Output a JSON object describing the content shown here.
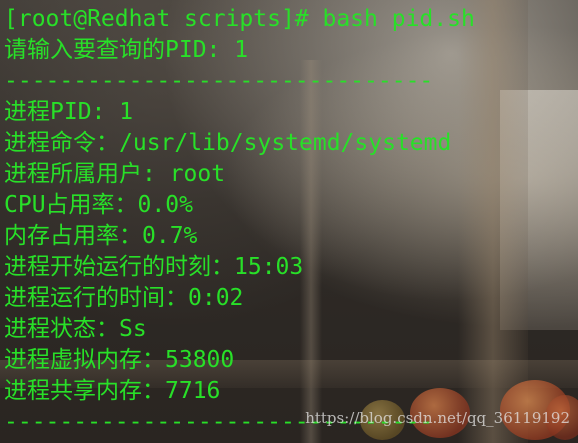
{
  "terminal": {
    "text_color": "#28e028",
    "lines": [
      "[root@Redhat scripts]# bash pid.sh",
      "请输入要查询的PID: 1",
      "-------------------------------",
      "进程PID: 1",
      "进程命令：/usr/lib/systemd/systemd",
      "进程所属用户: root",
      "CPU占用率：0.0%",
      "内存占用率：0.7%",
      "进程开始运行的时刻：15:03",
      "进程运行的时间：0:02",
      "进程状态：Ss",
      "进程虚拟内存：53800",
      "进程共享内存：7716",
      "-------------------------------"
    ]
  },
  "watermark": "https://blog.csdn.net/qq_36119192"
}
